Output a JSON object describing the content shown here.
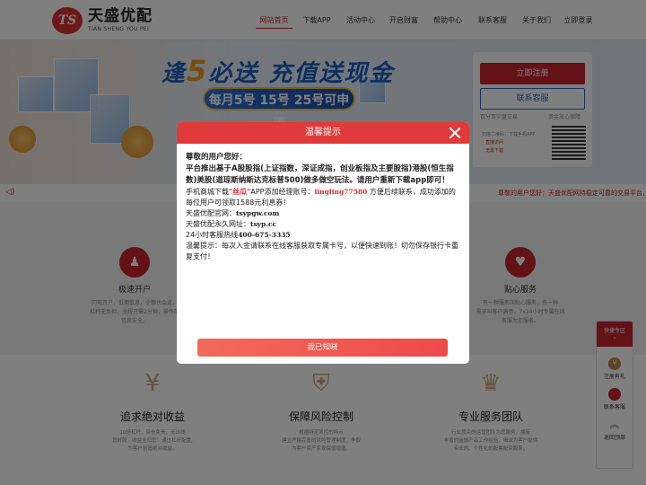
{
  "brand": {
    "name_cn": "天盛优配",
    "name_en": "TIAN SHENG YOU PEI",
    "mark": "TS"
  },
  "nav": [
    "网站首页",
    "下载APP",
    "活动中心",
    "开启财富",
    "帮助中心",
    "联系客服",
    "关于我们",
    "立即登录"
  ],
  "banner": {
    "title_a": "逢",
    "title_five": "5",
    "title_b": "必送 充值送现金",
    "subtitle": "每月5号 15号 25号可申请"
  },
  "panel": {
    "register": "立即注册",
    "service": "联系客服",
    "note_left": "百分百实盘交易",
    "note_right": "资金放心保障",
    "qr_line1": "扫描二维码，下载手机APP",
    "qr_line2": "直接访问",
    "qr_line3": "无需下载"
  },
  "notice": {
    "text": "尊敬的用户您好：天盛优配网持稳定可靠的交易平台，"
  },
  "features": [
    {
      "icon": "person",
      "title": "极速开户",
      "desc1": "闪电开户，低佣低息，全额也会返，",
      "desc2": "杠杆无负担，全程只需2分钟，操作简",
      "desc3": "信息安全。"
    },
    {
      "icon": "heart",
      "title": "贴心服务",
      "desc1": "有一种服务叫贴心服务，有一种",
      "desc2": "需求叫客户满意，7x24小时专属在线",
      "desc3": "客服为您服务。"
    }
  ],
  "advantages": [
    {
      "title": "追求绝对收益",
      "desc1": "10倍杠杆，穿仓免责，无出线",
      "desc2": "您好股，收益全归您！通过杠杆配置,",
      "desc3": "为客户创造绝对收益。"
    },
    {
      "title": "保障风险控制",
      "desc1": "根据特定风控的特点",
      "desc2": "建立严格完善的风险管理制度，争取",
      "desc3": "为客户资产实现保值增值。"
    },
    {
      "title": "专业服务团队",
      "desc1": "行业顶尖的运营团队为您服务，拥有",
      "desc2": "丰富的金融产品工作经验，竭诚为客户提供",
      "desc3": "专业的、个性化的股票配资服务。"
    }
  ],
  "float_bar": {
    "head": "快捷专区",
    "items": [
      "注册有礼",
      "联系客服",
      "返回顶部"
    ]
  },
  "modal": {
    "title": "温馨提示",
    "greeting": "尊敬的用户您好：",
    "announce": "平台推出基于A股股指(上证指数，深证成指，创业板指及主要股指)港股(恒生指数)美股(道琼斯纳斯达克标普500)做多做空玩法。请用户重新下载app即可！",
    "l1_a": "手机商城下载",
    "l1_app": "\"丝瓜\"",
    "l1_b": "APP添加经理账号：",
    "l1_acct": "lingling77580",
    "l1_c": " 方便后续联系，成功添加的每位用户可领取1588元利息券！",
    "l2_a": "天盛优配官网：",
    "l2_b": "tsypgw.com",
    "l3_a": "天盛优配永久网址：",
    "l3_b": "tsyp.cc",
    "l4_a": "24小时客服热线",
    "l4_b": "400-675-3335",
    "l5": "温馨提示：每次入金请联系在线客服获取专属卡号，以便快速到账！切勿保存银行卡重复支付！",
    "button": "我已知晓"
  }
}
